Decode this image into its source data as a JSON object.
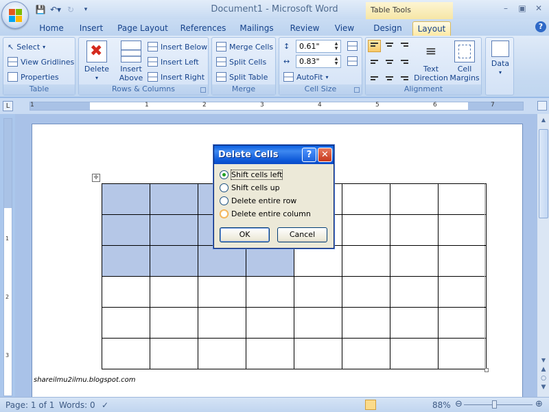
{
  "window": {
    "title": "Document1 - Microsoft Word",
    "contextual_label": "Table Tools"
  },
  "tabs": [
    "Home",
    "Insert",
    "Page Layout",
    "References",
    "Mailings",
    "Review",
    "View",
    "Design",
    "Layout"
  ],
  "active_tab": "Layout",
  "ribbon": {
    "table_group": {
      "label": "Table",
      "select": "Select",
      "view_gridlines": "View Gridlines",
      "properties": "Properties"
    },
    "rows_columns_group": {
      "label": "Rows & Columns",
      "delete": "Delete",
      "insert_above_line1": "Insert",
      "insert_above_line2": "Above",
      "insert_below": "Insert Below",
      "insert_left": "Insert Left",
      "insert_right": "Insert Right"
    },
    "merge_group": {
      "label": "Merge",
      "merge_cells": "Merge Cells",
      "split_cells": "Split Cells",
      "split_table": "Split Table"
    },
    "cell_size_group": {
      "label": "Cell Size",
      "height": "0.61\"",
      "width": "0.83\"",
      "autofit": "AutoFit"
    },
    "alignment_group": {
      "label": "Alignment",
      "text_direction_line1": "Text",
      "text_direction_line2": "Direction",
      "cell_margins_line1": "Cell",
      "cell_margins_line2": "Margins"
    },
    "data_group": {
      "data": "Data"
    }
  },
  "ruler": {
    "numbers": [
      "1",
      "1",
      "2",
      "3",
      "4",
      "5",
      "6",
      "7"
    ]
  },
  "vruler": {
    "numbers": [
      "1",
      "2",
      "3"
    ]
  },
  "document": {
    "table": {
      "rows": 6,
      "cols": 8,
      "selected": [
        [
          true,
          true,
          true,
          true,
          false,
          false,
          false,
          false
        ],
        [
          true,
          true,
          true,
          true,
          false,
          false,
          false,
          false
        ],
        [
          true,
          true,
          true,
          true,
          false,
          false,
          false,
          false
        ],
        [
          false,
          false,
          false,
          false,
          false,
          false,
          false,
          false
        ],
        [
          false,
          false,
          false,
          false,
          false,
          false,
          false,
          false
        ],
        [
          false,
          false,
          false,
          false,
          false,
          false,
          false,
          false
        ]
      ]
    },
    "watermark": "shareilmu2ilmu.blogspot.com"
  },
  "dialog": {
    "title": "Delete Cells",
    "help": "?",
    "close": "✕",
    "options": [
      "Shift cells left",
      "Shift cells up",
      "Delete entire row",
      "Delete entire column"
    ],
    "selected_option": 0,
    "ok": "OK",
    "cancel": "Cancel"
  },
  "status": {
    "page": "Page: 1 of 1",
    "words": "Words: 0",
    "zoom": "88%"
  },
  "colors": {
    "selection": "#b5c7e7",
    "ribbon": "#c5d9f1",
    "dialog_title": "#0a5ee0"
  }
}
